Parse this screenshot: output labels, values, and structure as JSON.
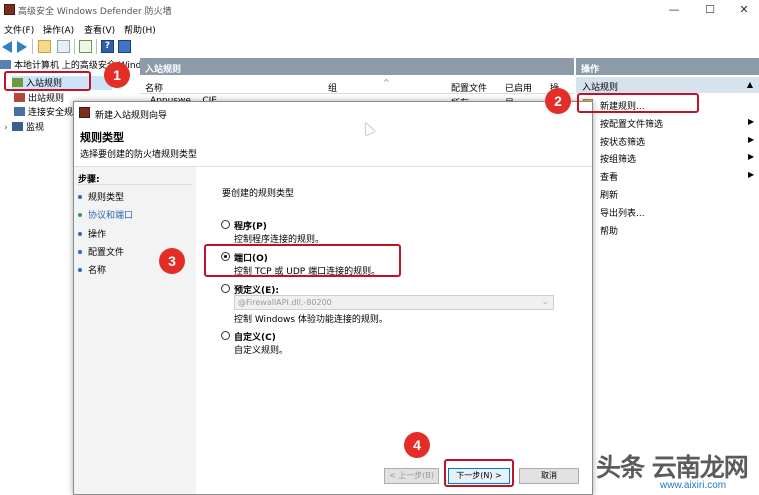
{
  "window": {
    "title": "高级安全 Windows Defender 防火墙",
    "minimize": "—",
    "maximize": "☐",
    "close": "✕"
  },
  "menu": [
    "文件(F)",
    "操作(A)",
    "查看(V)",
    "帮助(H)"
  ],
  "tree": {
    "root": "本地计算机 上的高级安全 Windo",
    "items": [
      "入站规则",
      "出站规则",
      "连接安全规",
      "监视"
    ]
  },
  "middle": {
    "header": "入站规则",
    "columns": [
      "名称",
      "组",
      "配置文件",
      "已启用",
      "操"
    ],
    "row": {
      "name": "Appuswe... CIE",
      "profile": "所有",
      "enabled": "是"
    }
  },
  "actions": {
    "header": "操作",
    "section": "入站规则",
    "items": [
      {
        "label": "新建规则...",
        "has_arrow": false
      },
      {
        "label": "按配置文件筛选",
        "has_arrow": true
      },
      {
        "label": "按状态筛选",
        "has_arrow": true
      },
      {
        "label": "按组筛选",
        "has_arrow": true
      },
      {
        "label": "查看",
        "has_arrow": true
      },
      {
        "label": "刷新",
        "has_arrow": false
      },
      {
        "label": "导出列表...",
        "has_arrow": false
      },
      {
        "label": "帮助",
        "has_arrow": false
      }
    ]
  },
  "dialog": {
    "title": "新建入站规则向导",
    "heading": "规则类型",
    "subheading": "选择要创建的防火墙规则类型",
    "steps_title": "步骤:",
    "steps": [
      "规则类型",
      "协议和端口",
      "操作",
      "配置文件",
      "名称"
    ],
    "question": "要创建的规则类型",
    "options": [
      {
        "label": "程序(P)",
        "desc": "控制程序连接的规则。",
        "selected": false
      },
      {
        "label": "端口(O)",
        "desc": "控制 TCP 或 UDP 端口连接的规则。",
        "selected": true
      },
      {
        "label": "预定义(E):",
        "desc": "控制 Windows 体验功能连接的规则。",
        "selected": false
      },
      {
        "label": "自定义(C)",
        "desc": "自定义规则。",
        "selected": false
      }
    ],
    "predefined_value": "@FirewallAPI.dll,-80200",
    "buttons": {
      "back": "< 上一步(B)",
      "next": "下一步(N) >",
      "cancel": "取消"
    }
  },
  "annotations": [
    "1",
    "2",
    "3",
    "4"
  ],
  "watermark": {
    "text": "头条 云南龙网",
    "url": "www.aixiri.com"
  }
}
